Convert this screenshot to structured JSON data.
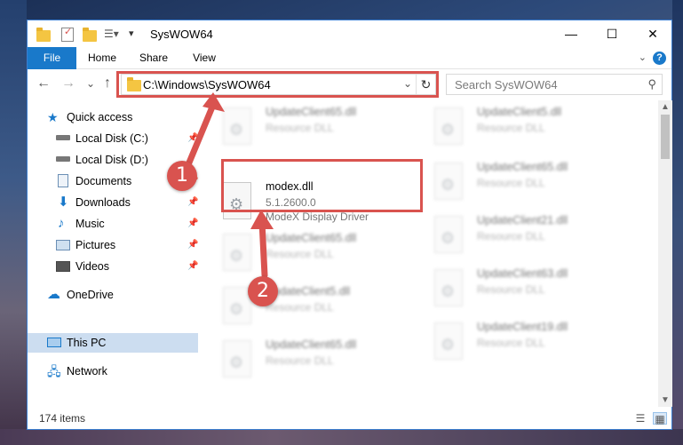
{
  "window": {
    "title": "SysWOW64",
    "minimize_glyph": "—",
    "maximize_glyph": "☐",
    "close_glyph": "✕"
  },
  "ribbon": {
    "tabs": [
      "File",
      "Home",
      "Share",
      "View"
    ],
    "help_glyph": "?"
  },
  "navigation": {
    "back_glyph": "←",
    "forward_glyph": "→",
    "recent_glyph": "⌄",
    "up_glyph": "↑",
    "address": "C:\\Windows\\SysWOW64",
    "search_placeholder": "Search SysWOW64"
  },
  "sidebar": {
    "items": [
      {
        "label": "Quick access",
        "icon": "star-icon"
      },
      {
        "label": "Local Disk (C:)",
        "icon": "drive-icon",
        "pinned": true
      },
      {
        "label": "Local Disk (D:)",
        "icon": "drive-icon",
        "pinned": true
      },
      {
        "label": "Documents",
        "icon": "documents-icon",
        "pinned": true
      },
      {
        "label": "Downloads",
        "icon": "downloads-icon",
        "pinned": true
      },
      {
        "label": "Music",
        "icon": "music-icon",
        "pinned": true
      },
      {
        "label": "Pictures",
        "icon": "pictures-icon",
        "pinned": true
      },
      {
        "label": "Videos",
        "icon": "videos-icon",
        "pinned": true
      },
      {
        "label": "OneDrive",
        "icon": "cloud-icon"
      },
      {
        "label": "This PC",
        "icon": "computer-icon",
        "selected": true
      },
      {
        "label": "Network",
        "icon": "network-icon"
      }
    ]
  },
  "files": {
    "focused": {
      "name": "modex.dll",
      "version": "5.1.2600.0",
      "description": "ModeX Display Driver"
    },
    "left_column": [
      {
        "name": "UpdateClient65.dll",
        "description": "Resource DLL"
      },
      {
        "name": "UpdateClient65.dll",
        "description": "Resource DLL"
      },
      {
        "name": "UpdateClient5.dll",
        "description": "Resource DLL"
      },
      {
        "name": "UpdateClient65.dll",
        "description": "Resource DLL"
      }
    ],
    "right_column": [
      {
        "name": "UpdateClient5.dll",
        "description": "Resource DLL"
      },
      {
        "name": "UpdateClient65.dll",
        "description": "Resource DLL"
      },
      {
        "name": "UpdateClient21.dll",
        "description": "Resource DLL"
      },
      {
        "name": "UpdateClient63.dll",
        "description": "Resource DLL"
      },
      {
        "name": "UpdateClient19.dll",
        "description": "Resource DLL"
      }
    ]
  },
  "status": {
    "item_count": "174 items"
  },
  "annotations": {
    "step1": "1",
    "step2": "2",
    "color": "#d9534f"
  }
}
